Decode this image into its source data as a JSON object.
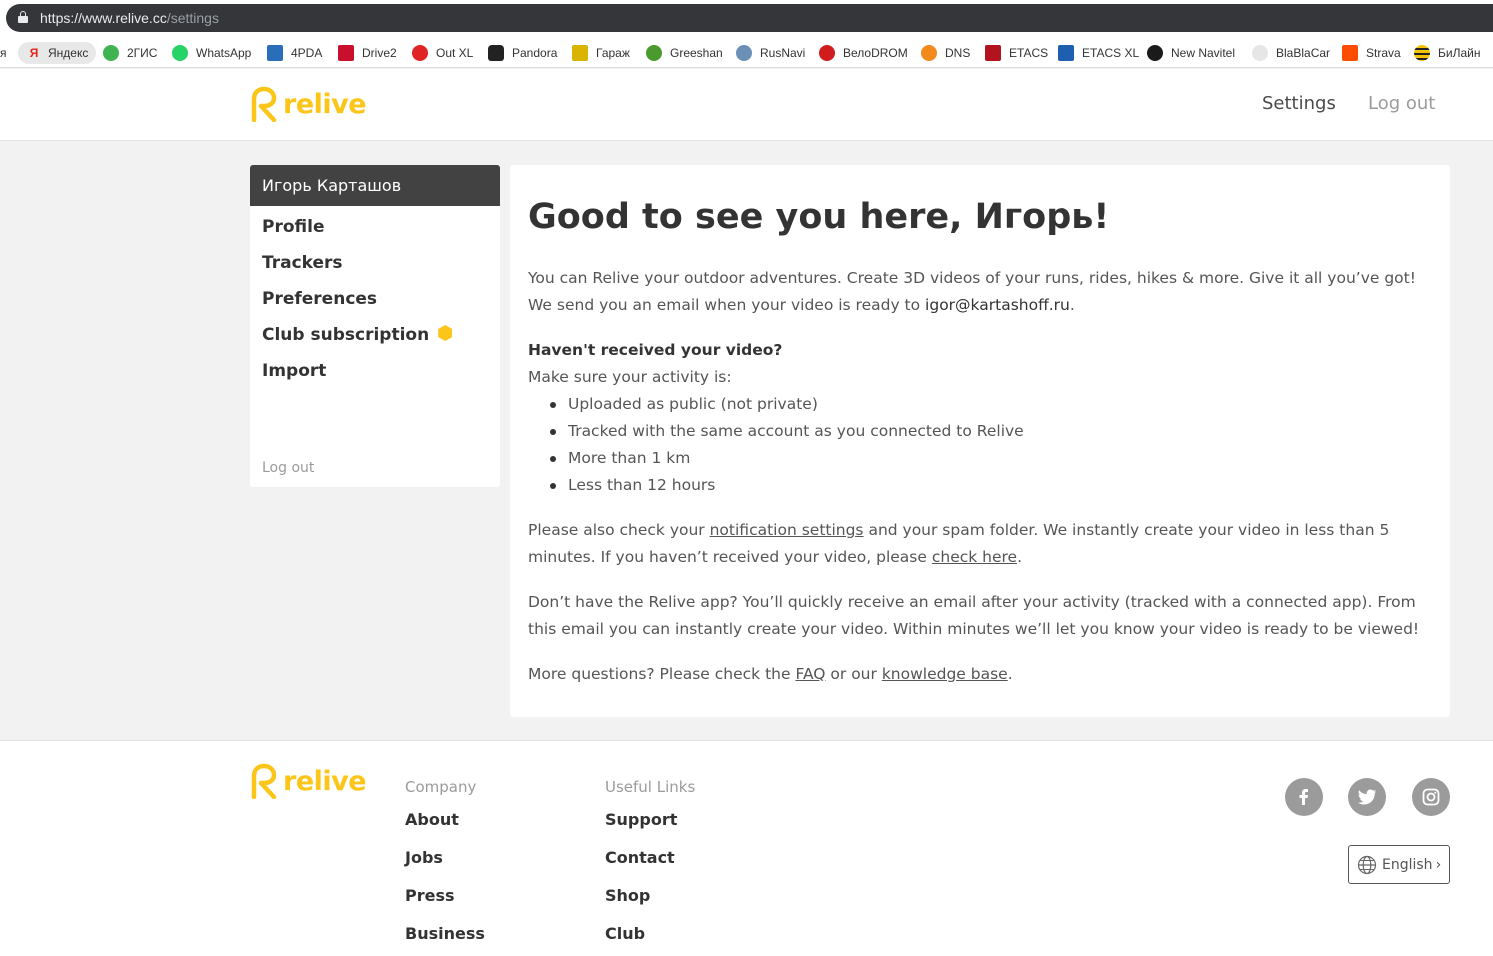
{
  "browser": {
    "url_host": "https://www.relive.cc",
    "url_path": "/settings",
    "bookmarks": [
      {
        "label": "я",
        "icon": "partial-bookmark"
      },
      {
        "label": "Яндекс",
        "icon": "yandex-icon"
      },
      {
        "label": "2ГИС",
        "icon": "2gis-icon"
      },
      {
        "label": "WhatsApp",
        "icon": "whatsapp-icon"
      },
      {
        "label": "4PDA",
        "icon": "4pda-icon"
      },
      {
        "label": "Drive2",
        "icon": "drive2-icon"
      },
      {
        "label": "Out XL",
        "icon": "outxl-icon"
      },
      {
        "label": "Pandora",
        "icon": "pandora-icon"
      },
      {
        "label": "Гараж",
        "icon": "garage-icon"
      },
      {
        "label": "Greeshan",
        "icon": "greeshan-icon"
      },
      {
        "label": "RusNavi",
        "icon": "rusnavi-icon"
      },
      {
        "label": "ВелоDROM",
        "icon": "velodrom-icon"
      },
      {
        "label": "DNS",
        "icon": "dns-icon"
      },
      {
        "label": "ETACS",
        "icon": "etacs-icon"
      },
      {
        "label": "ETACS XL",
        "icon": "etacs-xl-icon"
      },
      {
        "label": "New Navitel",
        "icon": "navitel-icon"
      },
      {
        "label": "BlaBlaCar",
        "icon": "blablacar-icon"
      },
      {
        "label": "Strava",
        "icon": "strava-icon"
      },
      {
        "label": "БиЛайн",
        "icon": "beeline-icon"
      }
    ]
  },
  "header": {
    "logo_text": "relive",
    "nav_settings": "Settings",
    "nav_logout": "Log out"
  },
  "sidebar": {
    "user_name": "Игорь Карташов",
    "items": [
      {
        "label": "Profile"
      },
      {
        "label": "Trackers"
      },
      {
        "label": "Preferences"
      },
      {
        "label": "Club subscription"
      },
      {
        "label": "Import"
      }
    ],
    "logout": "Log out"
  },
  "main": {
    "heading": "Good to see you here, Игорь!",
    "intro_1": "You can Relive your outdoor adventures. Create 3D videos of your runs, rides, hikes & more. Give it all you’ve got! We send you an email when your video is ready to ",
    "intro_email": "igor@kartashoff.ru",
    "intro_2": ".",
    "question": "Haven't received your video?",
    "make_sure": "Make sure your activity is:",
    "checklist": [
      "Uploaded as public (not private)",
      "Tracked with the same account as you connected to Relive",
      "More than 1 km",
      "Less than 12 hours"
    ],
    "check_1": "Please also check your ",
    "check_link_1": "notification settings",
    "check_2": " and your spam folder. We instantly create your video in less than 5 minutes. If you haven’t received your video, please ",
    "check_link_2": "check here",
    "check_3": ".",
    "noapp": "Don’t have the Relive app? You’ll quickly receive an email after your activity (tracked with a connected app). From this email you can instantly create your video. Within minutes we’ll let you know your video is ready to be viewed!",
    "more_1": "More questions? Please check the ",
    "more_link_faq": "FAQ",
    "more_2": " or our ",
    "more_link_kb": "knowledge base",
    "more_3": "."
  },
  "footer": {
    "logo_text": "relive",
    "company_title": "Company",
    "company_links": [
      "About",
      "Jobs",
      "Press",
      "Business"
    ],
    "useful_title": "Useful Links",
    "useful_links": [
      "Support",
      "Contact",
      "Shop",
      "Club"
    ],
    "social": [
      "facebook-icon",
      "twitter-icon",
      "instagram-icon"
    ],
    "language": "English"
  },
  "colors": {
    "brand_yellow": "#fcc51a",
    "sidebar_header": "#424242",
    "page_bg": "#f2f2f2"
  }
}
